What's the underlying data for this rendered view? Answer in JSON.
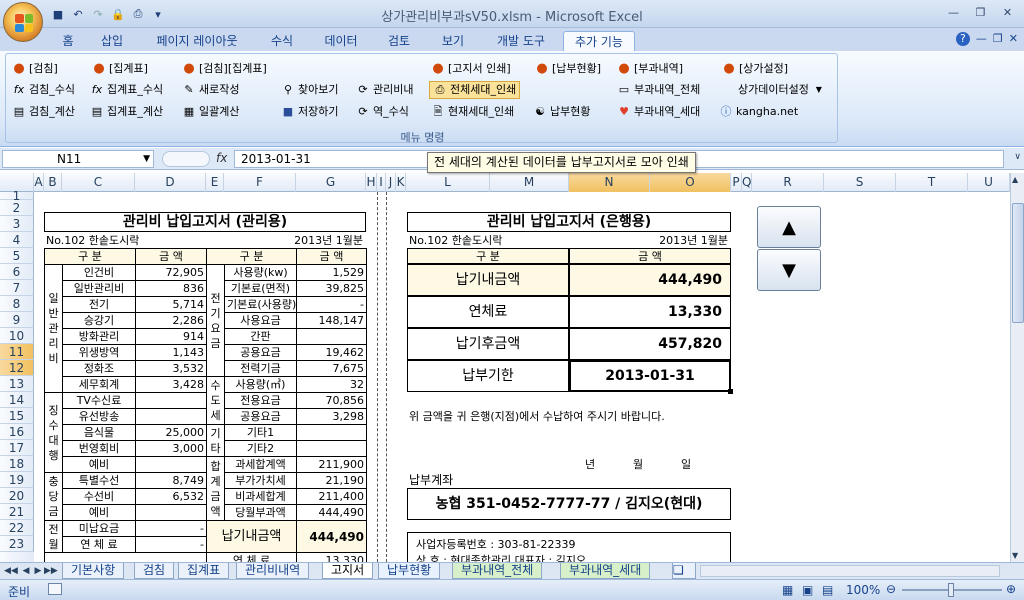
{
  "window": {
    "title": "상가관리비부과sV50.xlsm  -  Microsoft Excel",
    "controls": [
      "minimize-icon",
      "restore-icon",
      "close-icon"
    ]
  },
  "ribbon_tabs": [
    "홈",
    "삽입",
    "페이지 레이아웃",
    "수식",
    "데이터",
    "검토",
    "보기",
    "개발 도구",
    "추가 기능"
  ],
  "active_tab": "추가 기능",
  "ribbon": {
    "group_label": "메뉴 명령",
    "row1": [
      "[검침]",
      "[집계표]",
      "[검침][집계표]",
      "[고지서 인쇄]",
      "[납부현황]",
      "[부과내역]",
      "[상가설정]"
    ],
    "row2": [
      "검침_수식",
      "집계표_수식",
      "새로작성",
      "찾아보기",
      "관리비내",
      "전체세대_인쇄",
      "부과내역_전체",
      "상가데이터설정"
    ],
    "row3": [
      "검침_계산",
      "집계표_계산",
      "일괄계산",
      "저장하기",
      "역_수식",
      "현재세대_인쇄",
      "납부현황",
      "부과내역_세대",
      "kangha.net"
    ]
  },
  "formula_bar": {
    "name_box": "N11",
    "fx": "fx",
    "content": "2013-01-31"
  },
  "tooltip": "전 세대의 계산된 데이터를 납부고지서로 모아 인쇄",
  "columns": [
    "A",
    "B",
    "C",
    "D",
    "E",
    "F",
    "G",
    "H",
    "I",
    "J",
    "K",
    "L",
    "M",
    "N",
    "O",
    "P",
    "Q",
    "R",
    "S",
    "T",
    "U"
  ],
  "rows": [
    "1",
    "2",
    "3",
    "4",
    "5",
    "6",
    "7",
    "8",
    "9",
    "10",
    "11",
    "12",
    "13",
    "14",
    "15",
    "16",
    "17",
    "18",
    "19",
    "20",
    "21",
    "22",
    "23"
  ],
  "left_form": {
    "title": "관리비 납입고지서 (관리용)",
    "store": "No.102  한솥도시락",
    "period": "2013년 1월분",
    "h1": "구  분",
    "h2": "금  액",
    "h3": "구  분",
    "h4": "금  액",
    "groups": {
      "g1": "일반관리비",
      "g2": "징수대행",
      "g3": "충당금",
      "g4": "전월",
      "g5": "전기요금",
      "g6": "수도세",
      "g7": "기타",
      "g8": "합계금액"
    },
    "left_items": [
      [
        "인건비",
        "72,905"
      ],
      [
        "일반관리비",
        "836"
      ],
      [
        "전기",
        "5,714"
      ],
      [
        "승강기",
        "2,286"
      ],
      [
        "방화관리",
        "914"
      ],
      [
        "위생방역",
        "1,143"
      ],
      [
        "정화조",
        "3,532"
      ],
      [
        "세무회계",
        "3,428"
      ],
      [
        "TV수신료",
        ""
      ],
      [
        "유선방송",
        ""
      ],
      [
        "음식물",
        "25,000"
      ],
      [
        "번영회비",
        "3,000"
      ],
      [
        "예비",
        ""
      ],
      [
        "특별수선",
        "8,749"
      ],
      [
        "수선비",
        "6,532"
      ],
      [
        "예비",
        ""
      ],
      [
        "미납요금",
        "-"
      ],
      [
        "연 체 료",
        "-"
      ]
    ],
    "right_items": [
      [
        "사용량(kw)",
        "1,529"
      ],
      [
        "기본료(면적)",
        "39,825"
      ],
      [
        "기본료(사용량)",
        "-"
      ],
      [
        "사용요금",
        "148,147"
      ],
      [
        "간판",
        ""
      ],
      [
        "공용요금",
        "19,462"
      ],
      [
        "전력기금",
        "7,675"
      ],
      [
        "사용량(㎥)",
        "32"
      ],
      [
        "전용요금",
        "70,856"
      ],
      [
        "공용요금",
        "3,298"
      ],
      [
        "기타1",
        ""
      ],
      [
        "기타2",
        ""
      ],
      [
        "과세합계액",
        "211,900"
      ],
      [
        "부가가치세",
        "21,190"
      ],
      [
        "비과세합계",
        "211,400"
      ],
      [
        "당월부과액",
        "444,490"
      ]
    ],
    "due_label": "납기내금액",
    "due_value": "444,490",
    "late_label": "연  체  료",
    "late_value": "13,330"
  },
  "right_form": {
    "title": "관리비 납입고지서 (은행용)",
    "store": "No.102  한솥도시락",
    "period": "2013년 1월분",
    "h1": "구  분",
    "h2": "금  액",
    "rows": [
      [
        "납기내금액",
        "444,490"
      ],
      [
        "연체료",
        "13,330"
      ],
      [
        "납기후금액",
        "457,820"
      ],
      [
        "납부기한",
        "2013-01-31"
      ]
    ],
    "notice": "위 금액을 귀 은행(지점)에서 수납하여 주시기 바랍니다.",
    "date_labels": [
      "년",
      "월",
      "일"
    ],
    "account_label": "납부계좌",
    "account": "농협 351-0452-7777-77 / 김지오(현대)",
    "biz_no": "사업자등록번호 : 303-81-22339",
    "bottom_partial": "상  호 : 현대종합관리          대표자 : 김지오"
  },
  "sheet_tabs": [
    "기본사항",
    "검침",
    "집계표",
    "관리비내역",
    "고지서",
    "납부현황",
    "부과내역_전체",
    "부과내역_세대"
  ],
  "active_sheet": "고지서",
  "status": {
    "ready": "준비",
    "zoom": "100%"
  }
}
